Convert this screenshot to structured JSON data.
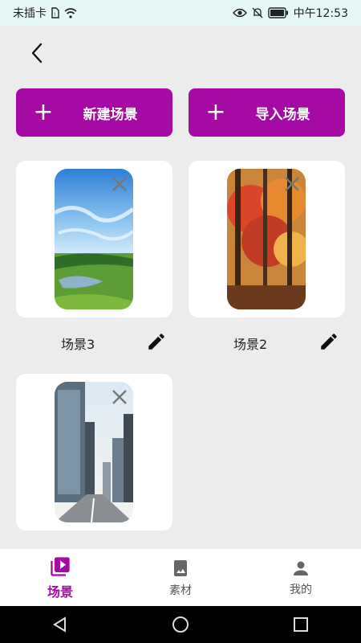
{
  "status_bar": {
    "carrier": "未插卡",
    "time": "中午12:53"
  },
  "actions": {
    "new_scene": "新建场景",
    "import_scene": "导入场景"
  },
  "scenes": [
    {
      "title": "场景3",
      "image": "green meadow under blue sky"
    },
    {
      "title": "场景2",
      "image": "autumn forest"
    },
    {
      "title": "",
      "image": "city street with buildings"
    }
  ],
  "bottom_nav": {
    "items": [
      {
        "label": "场景",
        "icon": "video-library-icon",
        "active": true
      },
      {
        "label": "素材",
        "icon": "photo-book-icon",
        "active": false
      },
      {
        "label": "我的",
        "icon": "person-icon",
        "active": false
      }
    ]
  },
  "colors": {
    "accent": "#a50aa5",
    "background": "#ececec",
    "status_bar": "#e6f7f7"
  }
}
